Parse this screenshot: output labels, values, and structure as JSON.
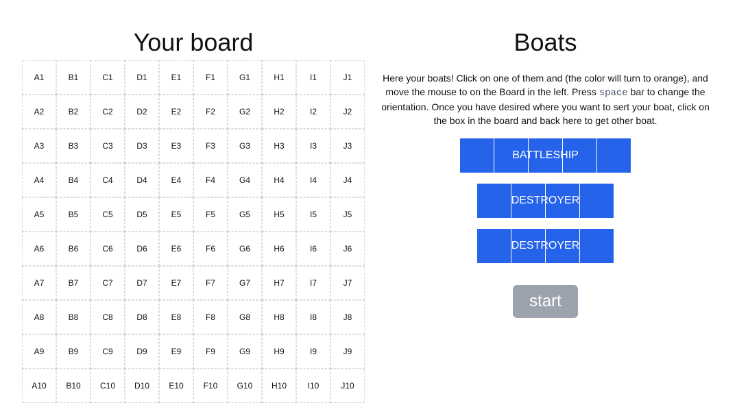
{
  "board": {
    "title": "Your board",
    "columns": [
      "A",
      "B",
      "C",
      "D",
      "E",
      "F",
      "G",
      "H",
      "I",
      "J"
    ],
    "rows": [
      "1",
      "2",
      "3",
      "4",
      "5",
      "6",
      "7",
      "8",
      "9",
      "10"
    ]
  },
  "boats_panel": {
    "title": "Boats",
    "instructions_before": "Here your boats! Click on one of them and (the color will turn to orange), and move the mouse to on the Board in the left. Press ",
    "instructions_key": "space",
    "instructions_after": " bar to change the orientation. Once you have desired where you want to sert your boat, click on the box in the board and back here to get other boat.",
    "boats": [
      {
        "name": "BATTLESHIP",
        "length": 5
      },
      {
        "name": "DESTROYER",
        "length": 4
      },
      {
        "name": "DESTROYER",
        "length": 4
      }
    ],
    "start_label": "start"
  },
  "colors": {
    "boat": "#2563eb",
    "boat_selected": "orange",
    "start_button": "#9ca3af"
  }
}
